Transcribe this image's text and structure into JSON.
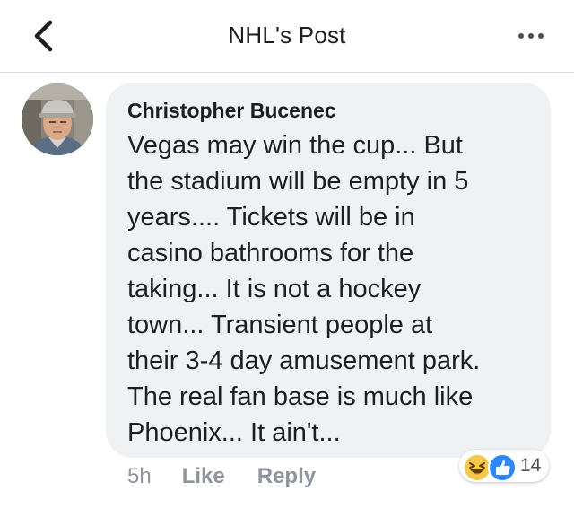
{
  "header": {
    "title": "NHL's Post",
    "back_icon": "chevron-left-icon",
    "more_icon": "more-horizontal-icon"
  },
  "comment": {
    "author": "Christopher Bucenec",
    "text": "Vegas may win the cup... But\nthe stadium will be empty in 5\nyears.... Tickets will be in\ncasino bathrooms for the\ntaking... It is not a hockey\ntown... Transient people at\ntheir 3-4 day amusement park.\nThe real fan base is much like\nPhoenix... It ain't...",
    "time": "5h",
    "like_label": "Like",
    "reply_label": "Reply",
    "reactions": {
      "types": [
        "haha",
        "like"
      ],
      "count": "14"
    }
  },
  "colors": {
    "bubble": "#f0f1f3",
    "text": "#1c1e21",
    "meta": "#90949c",
    "like_blue": "#2d88ff",
    "haha_yellow": "#f7c948"
  }
}
